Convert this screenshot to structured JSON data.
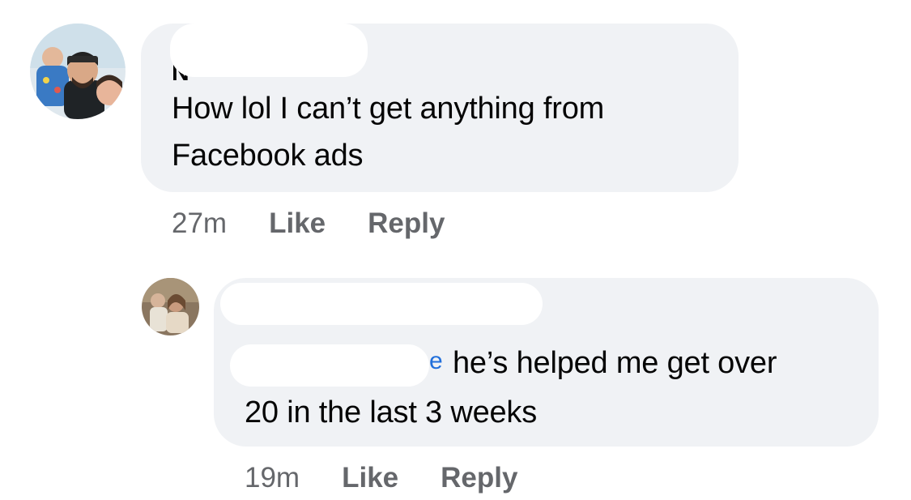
{
  "comments": [
    {
      "author_visible": "N",
      "text": "How lol I can’t get anything from\nFacebook ads",
      "time": "27m",
      "like_label": "Like",
      "reply_label": "Reply"
    },
    {
      "mention_visible": "e",
      "text_line1": "he’s helped me get over",
      "text_line2": "20 in the last 3 weeks",
      "time": "19m",
      "like_label": "Like",
      "reply_label": "Reply"
    }
  ],
  "colors": {
    "bubble": "#f0f2f5",
    "text": "#050505",
    "meta": "#65676b",
    "mention": "#216fdb",
    "redaction": "#ffffff"
  },
  "icons": {
    "avatar_1": "user-avatar-photo",
    "avatar_2": "user-avatar-photo"
  }
}
